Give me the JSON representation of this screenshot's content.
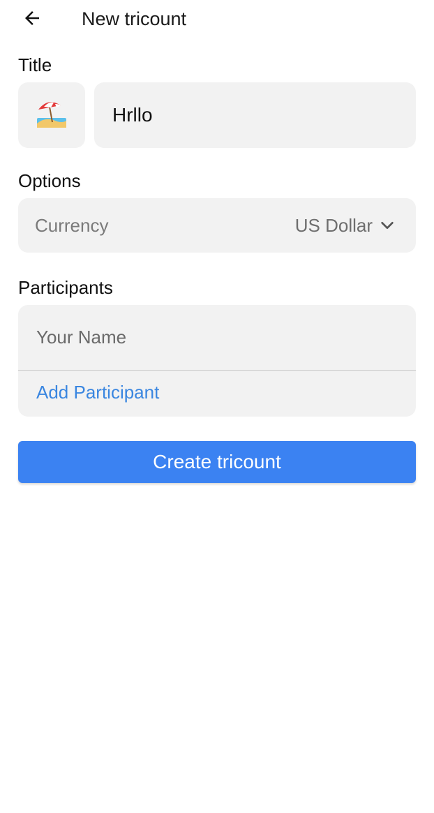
{
  "header": {
    "title": "New tricount",
    "back_icon": "arrow-left-icon"
  },
  "title_section": {
    "label": "Title",
    "emoji_icon": "beach-umbrella-emoji-icon",
    "input_value": "Hrllo"
  },
  "options_section": {
    "label": "Options",
    "currency_label": "Currency",
    "currency_value": "US Dollar",
    "dropdown_icon": "chevron-down-icon"
  },
  "participants_section": {
    "label": "Participants",
    "name_placeholder": "Your Name",
    "add_label": "Add Participant"
  },
  "actions": {
    "create_label": "Create tricount"
  },
  "colors": {
    "accent": "#3b82f2",
    "link": "#3a86e0",
    "field_bg": "#f2f2f2"
  }
}
